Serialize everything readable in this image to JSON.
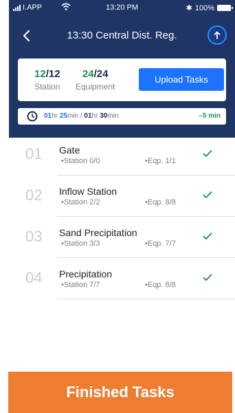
{
  "status_bar": {
    "carrier": "I.APP",
    "time": "13:20 PM",
    "bluetooth": "✱",
    "battery": "100%"
  },
  "nav": {
    "title": "13:30 Central Dist. Reg."
  },
  "summary": {
    "station_done": "12",
    "station_total": "/12",
    "station_label": "Station",
    "equipment_done": "24",
    "equipment_total": "/24",
    "equipment_label": "Equipment",
    "upload_label": "Upload Tasks"
  },
  "time_bar": {
    "elapsed_hr": "01",
    "hr_unit_1": "hr ",
    "elapsed_min": "25",
    "min_unit_1": "min",
    "separator": " / ",
    "planned_hr": "01",
    "hr_unit_2": "hr ",
    "planned_min": "30",
    "min_unit_2": "min",
    "diff": "–5 min"
  },
  "tasks": [
    {
      "num": "01",
      "name": "Gate",
      "station": "•Station 0/0",
      "eqp": "•Eqp. 1/1"
    },
    {
      "num": "02",
      "name": "Inflow Station",
      "station": "•Station 2/2",
      "eqp": "•Eqp. 8/8"
    },
    {
      "num": "03",
      "name": "Sand Precipitation",
      "station": "•Station 3/3",
      "eqp": "•Eqp. 7/7"
    },
    {
      "num": "04",
      "name": "Precipitation",
      "station": "•Station 7/7",
      "eqp": "•Eqp. 8/8"
    }
  ],
  "banner": {
    "label": "Finished Tasks"
  },
  "colors": {
    "header_bg": "#1f3566",
    "accent_blue": "#1d73ff",
    "success_green": "#1f8f4e",
    "banner_orange": "#ed7d31"
  },
  "icons": [
    "signal-icon",
    "wifi-icon",
    "bluetooth-icon",
    "battery-icon",
    "back-icon",
    "upload-icon",
    "clock-icon",
    "check-icon"
  ]
}
